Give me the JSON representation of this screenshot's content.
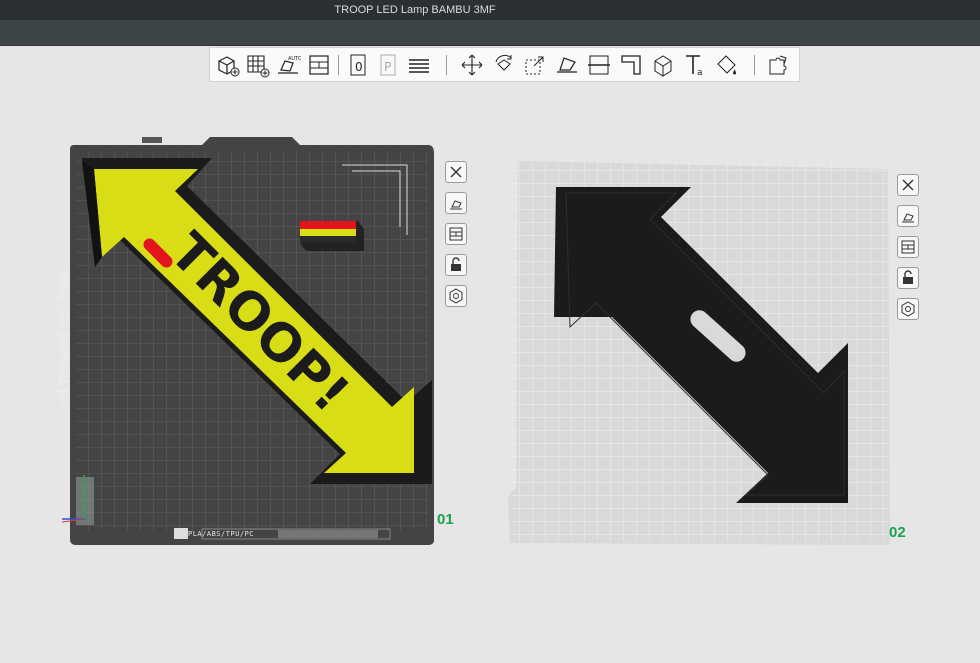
{
  "window": {
    "title": "TROOP LED Lamp BAMBU 3MF"
  },
  "toolbar": {
    "tools": [
      {
        "name": "add-object"
      },
      {
        "name": "add-plate"
      },
      {
        "name": "auto-orient"
      },
      {
        "name": "arrange"
      },
      {
        "name": "split-objects"
      },
      {
        "name": "split-parts"
      },
      {
        "name": "layers"
      },
      {
        "name": "move"
      },
      {
        "name": "rotate"
      },
      {
        "name": "scale"
      },
      {
        "name": "lay-on-face"
      },
      {
        "name": "cut"
      },
      {
        "name": "support-paint"
      },
      {
        "name": "seam-paint"
      },
      {
        "name": "text"
      },
      {
        "name": "color-paint"
      },
      {
        "name": "assembly"
      }
    ]
  },
  "plates": [
    {
      "number": "01",
      "bed_text": "ed Textured PEI Plate",
      "bed_footer": "PLA/ABS/TPU/PC",
      "model_text": "TROOP!",
      "side_tools": [
        "close",
        "auto-orient",
        "arrange",
        "lock",
        "settings"
      ]
    },
    {
      "number": "02",
      "side_tools": [
        "close",
        "auto-orient",
        "arrange",
        "lock",
        "settings"
      ]
    }
  ],
  "colors": {
    "accent_green": "#19a34a",
    "filament_yellow": "#d8dd16",
    "filament_black": "#1b1b1b",
    "filament_red": "#e3141b",
    "bed_dark": "#4a4a4a",
    "bed_light": "#d9d9d9"
  }
}
